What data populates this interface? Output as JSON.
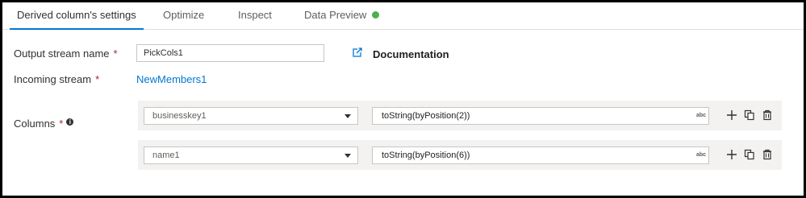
{
  "tabs": [
    {
      "label": "Derived column's settings",
      "active": true
    },
    {
      "label": "Optimize",
      "active": false
    },
    {
      "label": "Inspect",
      "active": false
    },
    {
      "label": "Data Preview",
      "active": false,
      "status_color": "#4caf50"
    }
  ],
  "form": {
    "output_stream": {
      "label": "Output stream name",
      "required_mark": "*",
      "value": "PickCols1"
    },
    "documentation": {
      "label": "Documentation",
      "icon": "external-link-icon"
    },
    "incoming_stream": {
      "label": "Incoming stream",
      "required_mark": "*",
      "value": "NewMembers1"
    },
    "columns": {
      "label": "Columns",
      "required_mark": "*",
      "info_glyph": "i",
      "rows": [
        {
          "column": "businesskey1",
          "expression": "toString(byPosition(2))",
          "type_badge": "abc"
        },
        {
          "column": "name1",
          "expression": "toString(byPosition(6))",
          "type_badge": "abc"
        }
      ]
    }
  },
  "colors": {
    "accent": "#0078d4",
    "required": "#a4262c",
    "row_background": "#f3f2f1"
  }
}
